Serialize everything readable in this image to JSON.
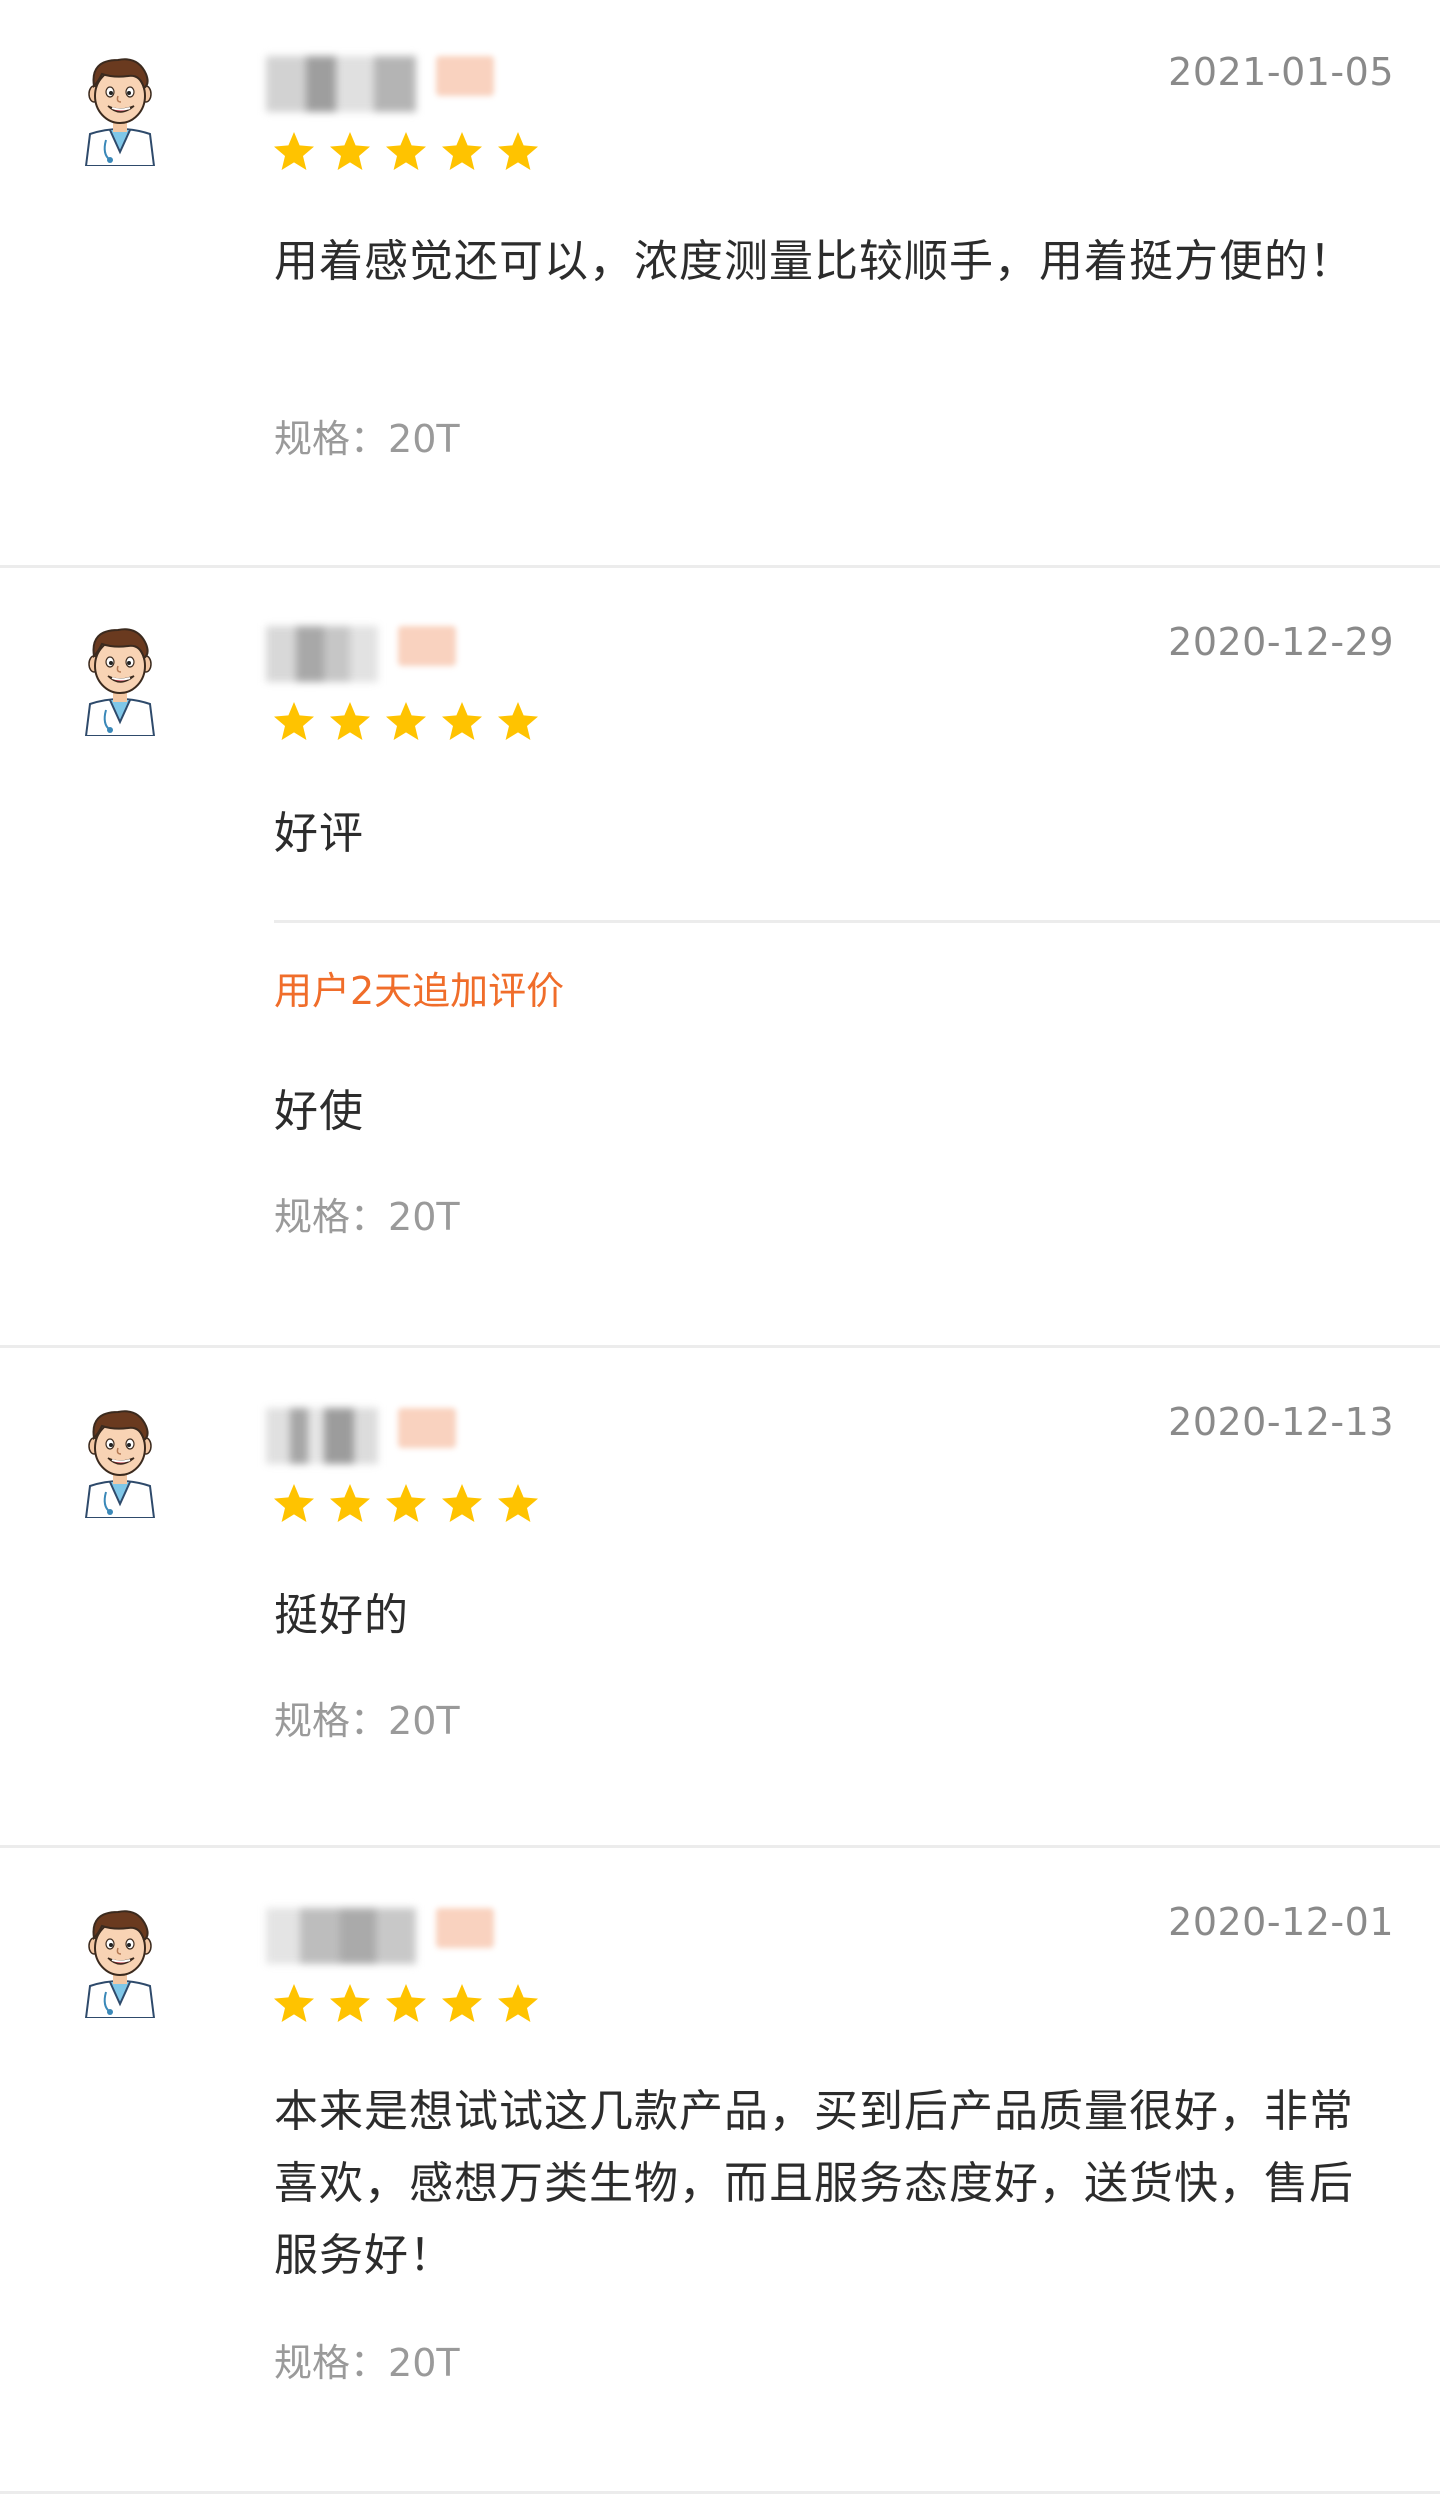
{
  "colors": {
    "star": "#ffc300",
    "followup_label": "#f06d2a",
    "date": "#8a8a8a",
    "spec": "#9a9a9a",
    "text": "#2c2c2c",
    "divider": "#ececec"
  },
  "reviews": [
    {
      "date": "2021-01-05",
      "rating": 5,
      "text": "用着感觉还可以，浓度测量比较顺手，用着挺方便的！",
      "spec_label": "规格：",
      "spec_value": "20T"
    },
    {
      "date": "2020-12-29",
      "rating": 5,
      "text": "好评",
      "followup_label": "用户2天追加评价",
      "followup_text": "好使",
      "spec_label": "规格：",
      "spec_value": "20T"
    },
    {
      "date": "2020-12-13",
      "rating": 5,
      "text": "挺好的",
      "spec_label": "规格：",
      "spec_value": "20T"
    },
    {
      "date": "2020-12-01",
      "rating": 5,
      "text": "本来是想试试这几款产品，买到后产品质量很好，非常喜欢，感想万类生物，而且服务态度好，送货快，售后服务好！",
      "spec_label": "规格：",
      "spec_value": "20T"
    }
  ]
}
